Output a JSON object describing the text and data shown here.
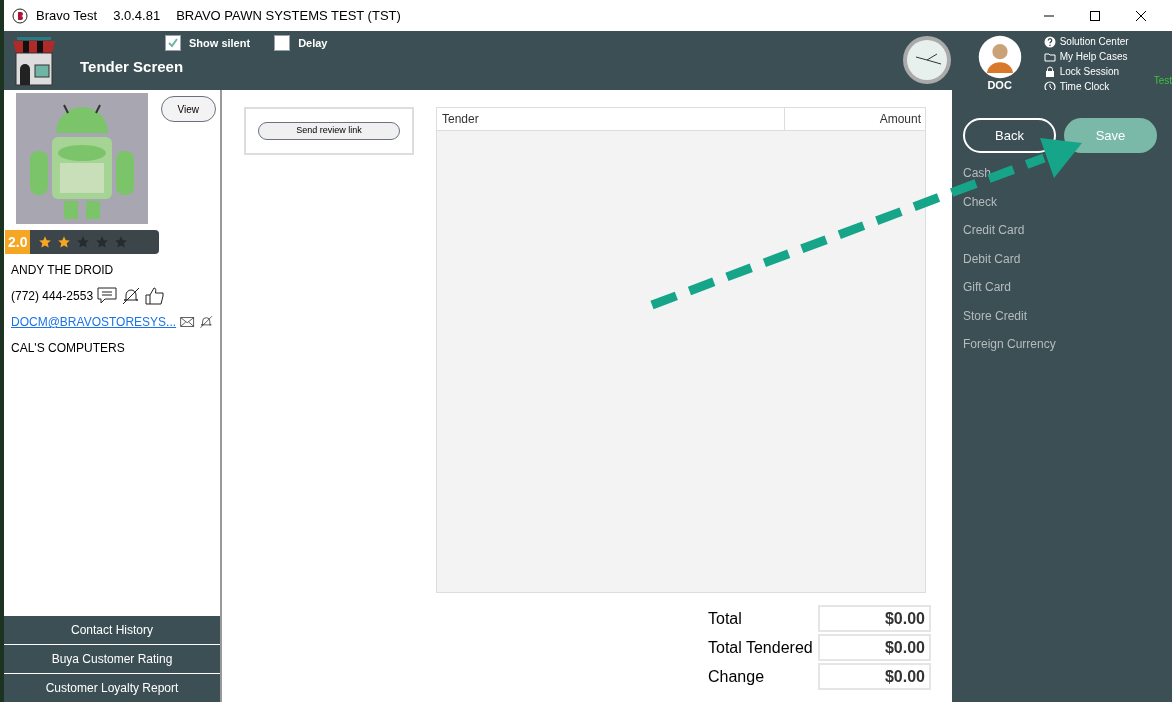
{
  "window": {
    "app_name": "Bravo Test",
    "version": "3.0.4.81",
    "title": "BRAVO PAWN SYSTEMS TEST (TST)"
  },
  "header": {
    "screen_title": "Tender Screen",
    "options": [
      {
        "label": "Show silent",
        "checked": true
      },
      {
        "label": "Delay",
        "checked": false
      }
    ],
    "user": "DOC",
    "links": [
      {
        "label": "Solution Center",
        "kind": "help"
      },
      {
        "label": "My Help Cases",
        "kind": "folder"
      },
      {
        "label": "Lock Session",
        "kind": "lock"
      },
      {
        "label": "Time Clock",
        "kind": "clock"
      }
    ],
    "env_label": "Test"
  },
  "customer": {
    "view_button": "View",
    "rating": "2.0",
    "stars": 2,
    "name": "ANDY THE DROID",
    "phone": "(772) 444-2553",
    "email": "DOCM@BRAVOSTORESYS...",
    "company": "CAL'S COMPUTERS",
    "buttons": [
      "Contact History",
      "Buya Customer Rating",
      "Customer Loyalty Report"
    ]
  },
  "review": {
    "button": "Send review link"
  },
  "table": {
    "columns": [
      "Tender",
      "Amount"
    ]
  },
  "totals": [
    {
      "label": "Total",
      "value": "$0.00"
    },
    {
      "label": "Total Tendered",
      "value": "$0.00"
    },
    {
      "label": "Change",
      "value": "$0.00"
    }
  ],
  "actions": {
    "back": "Back",
    "save": "Save"
  },
  "tender_types": [
    "Cash",
    "Check",
    "Credit Card",
    "Debit Card",
    "Gift Card",
    "Store Credit",
    "Foreign Currency"
  ]
}
